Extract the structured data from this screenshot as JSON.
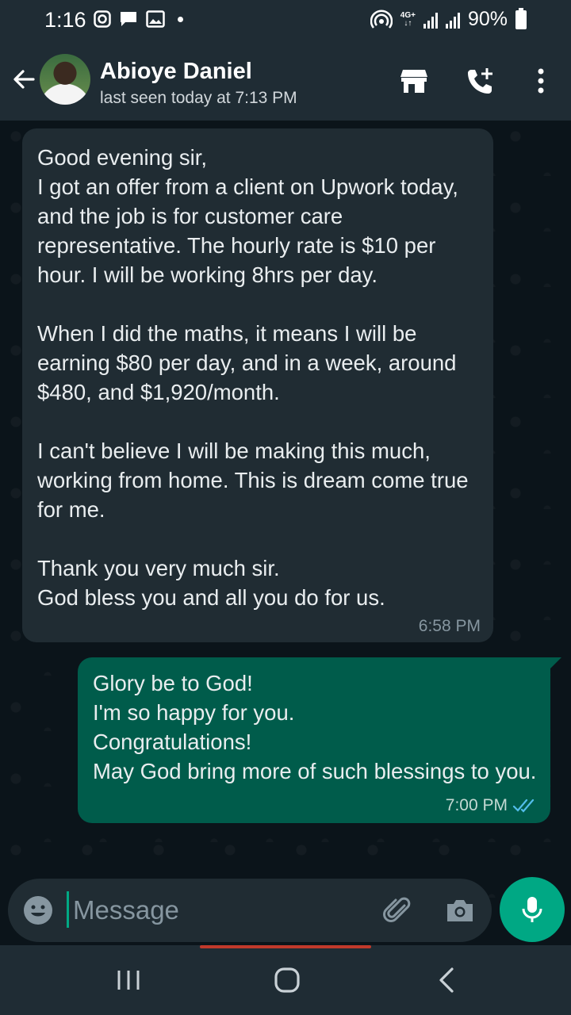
{
  "status_bar": {
    "time": "1:16",
    "network": "4G+",
    "battery": "90%"
  },
  "header": {
    "contact_name": "Abioye Daniel",
    "last_seen": "last seen today at 7:13 PM"
  },
  "messages": [
    {
      "direction": "incoming",
      "text": "Good evening sir,\nI got an offer from a client on Upwork today, and the job is for customer care representative. The hourly rate is $10 per hour. I will be working 8hrs per day.\n\nWhen I did the maths, it means I will be earning $80 per day, and in a week, around $480, and $1,920/month.\n\nI can't believe I will be making this much, working from home. This is dream come true for me.\n\nThank you very much sir.\nGod bless you and all you do for us.",
      "time": "6:58 PM"
    },
    {
      "direction": "outgoing",
      "text": "Glory be to God!\nI'm so happy for you.\nCongratulations!\nMay God bring more of such blessings to you.",
      "time": "7:00 PM",
      "status": "read"
    }
  ],
  "composer": {
    "placeholder": "Message"
  },
  "colors": {
    "header_bg": "#1f2c34",
    "chat_bg": "#0b141a",
    "incoming_bubble": "#202c33",
    "outgoing_bubble": "#005c4b",
    "accent": "#00a884",
    "read_ticks": "#53bdeb"
  },
  "icons": {
    "back": "arrow-left-icon",
    "store": "storefront-icon",
    "call": "add-call-icon",
    "more": "more-vertical-icon",
    "emoji": "emoji-icon",
    "attach": "paperclip-icon",
    "camera": "camera-icon",
    "mic": "microphone-icon"
  }
}
